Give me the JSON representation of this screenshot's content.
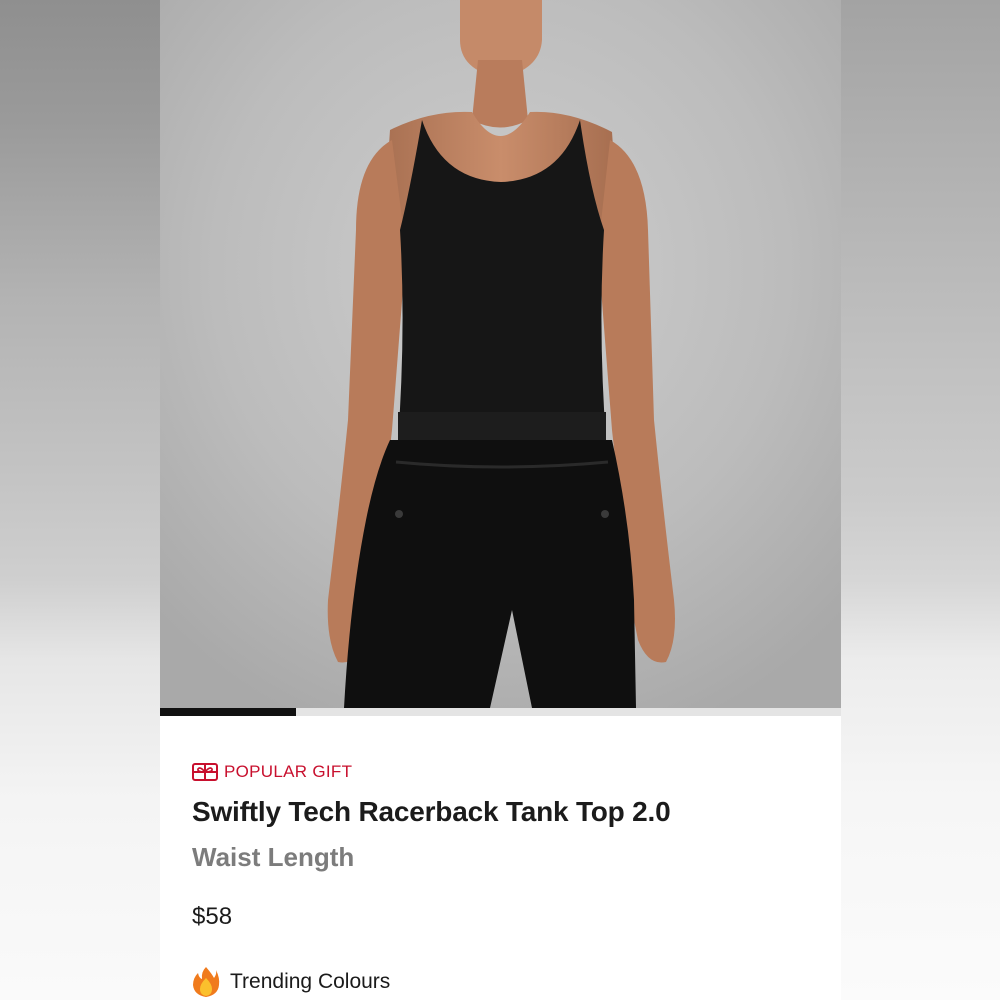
{
  "colors": {
    "badge": "#c8102e",
    "title": "#1b1b1b",
    "subtitle": "#7c7c7c",
    "progress_active": "#111111",
    "progress_track": "#e4e4e4"
  },
  "gallery": {
    "image_description_icon": "product-photo",
    "progress_fraction": 0.2
  },
  "product": {
    "badge_icon": "gift-icon",
    "badge_label": "POPULAR GIFT",
    "name": "Swiftly Tech Racerback Tank Top 2.0",
    "fit": "Waist Length",
    "price": "$58",
    "trending_icon": "fire-icon",
    "trending_label": "Trending Colours"
  }
}
